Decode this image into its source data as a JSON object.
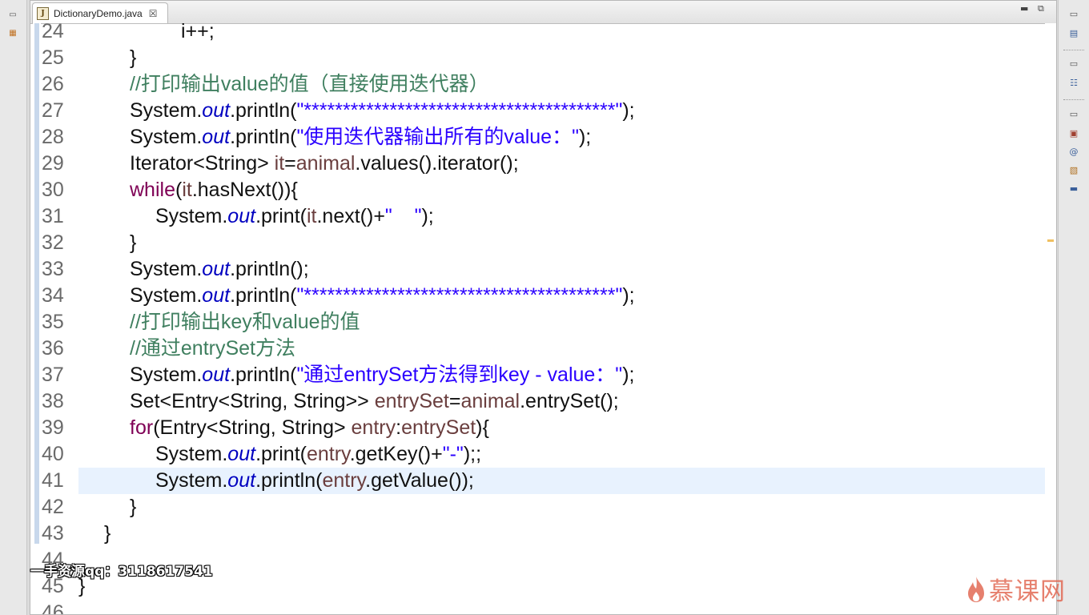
{
  "tab": {
    "title": "DictionaryDemo.java",
    "close": "☒"
  },
  "lines": [
    {
      "n": "24",
      "html": "i++;",
      "indent": 4
    },
    {
      "n": "25",
      "html": "}",
      "indent": 2
    },
    {
      "n": "26",
      "html": "<span class=\"cmt\">//打印输出value的值（直接使用迭代器）</span>",
      "indent": 2
    },
    {
      "n": "27",
      "html": "System.<span class=\"fld\">out</span>.println(<span class=\"str\">\"****************************************\"</span>);",
      "indent": 2
    },
    {
      "n": "28",
      "html": "System.<span class=\"fld\">out</span>.println(<span class=\"str\">\"使用迭代器输出所有的value：\"</span>);",
      "indent": 2
    },
    {
      "n": "29",
      "html": "Iterator&lt;String&gt; <span class=\"var\">it</span>=<span class=\"var\">animal</span>.values().iterator();",
      "indent": 2
    },
    {
      "n": "30",
      "html": "<span class=\"kw\">while</span>(<span class=\"var\">it</span>.hasNext()){",
      "indent": 2
    },
    {
      "n": "31",
      "html": "System.<span class=\"fld\">out</span>.print(<span class=\"var\">it</span>.next()+<span class=\"str\">\"    \"</span>);",
      "indent": 3
    },
    {
      "n": "32",
      "html": "}",
      "indent": 2
    },
    {
      "n": "33",
      "html": "System.<span class=\"fld\">out</span>.println();",
      "indent": 2
    },
    {
      "n": "34",
      "html": "System.<span class=\"fld\">out</span>.println(<span class=\"str\">\"****************************************\"</span>);",
      "indent": 2
    },
    {
      "n": "35",
      "html": "<span class=\"cmt\">//打印输出key和value的值</span>",
      "indent": 2
    },
    {
      "n": "36",
      "html": "<span class=\"cmt\">//通过entrySet方法</span>",
      "indent": 2
    },
    {
      "n": "37",
      "html": "System.<span class=\"fld\">out</span>.println(<span class=\"str\">\"通过entrySet方法得到key - value：\"</span>);",
      "indent": 2
    },
    {
      "n": "38",
      "html": "Set&lt;Entry&lt;String, String&gt;&gt; <span class=\"var\">entrySet</span>=<span class=\"var\">animal</span>.entrySet();",
      "indent": 2
    },
    {
      "n": "39",
      "html": "<span class=\"kw\">for</span>(Entry&lt;String, String&gt; <span class=\"var\">entry</span>:<span class=\"var\">entrySet</span>){",
      "indent": 2
    },
    {
      "n": "40",
      "html": "System.<span class=\"fld\">out</span>.print(<span class=\"var\">entry</span>.getKey()+<span class=\"str\">\"-\"</span>);;",
      "indent": 3
    },
    {
      "n": "41",
      "html": "System.<span class=\"fld\">out</span>.println(<span class=\"var\">entry</span>.getValue());",
      "indent": 3,
      "current": true
    },
    {
      "n": "42",
      "html": "}",
      "indent": 2
    },
    {
      "n": "43",
      "html": "}",
      "indent": 1
    },
    {
      "n": "44",
      "html": "",
      "indent": 0
    },
    {
      "n": "45",
      "html": "}",
      "indent": 0
    },
    {
      "n": "46",
      "html": "",
      "indent": 0
    }
  ],
  "watermark": "一手资源qq：3118617541",
  "logo_text": "慕课网",
  "colors": {
    "keyword": "#7f0055",
    "string": "#2a00ff",
    "comment": "#3f7f5f",
    "field": "#0000c0",
    "variable": "#6a3e3e",
    "current_line": "#e8f2fe"
  }
}
